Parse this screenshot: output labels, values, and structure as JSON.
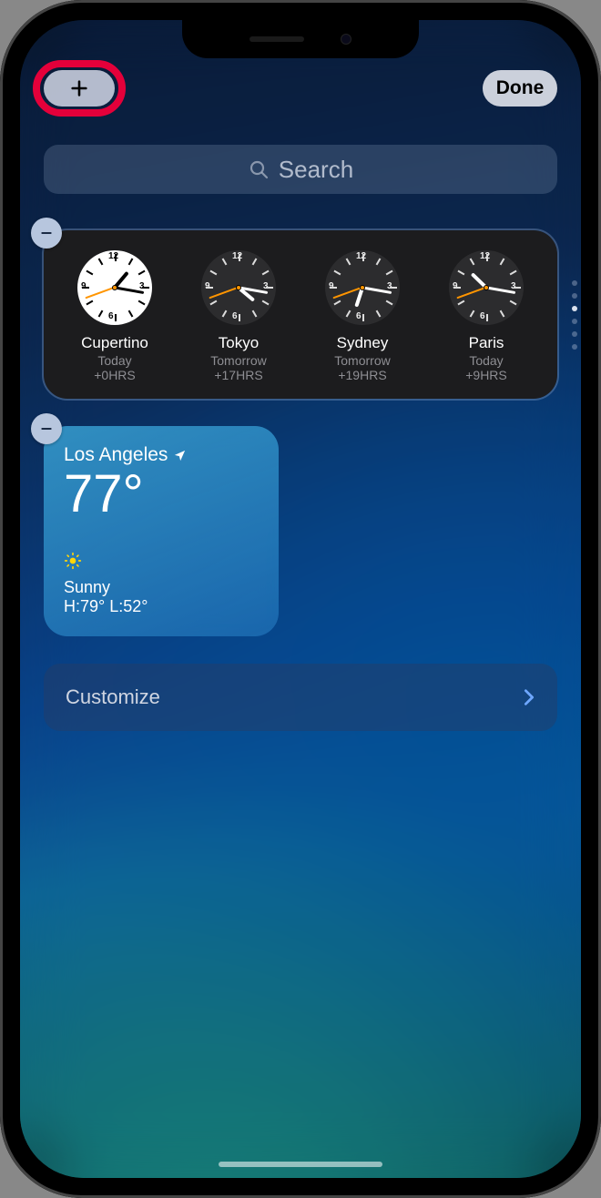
{
  "top": {
    "add_label": "+",
    "done_label": "Done"
  },
  "search": {
    "placeholder": "Search"
  },
  "world_clock": {
    "page_count": 6,
    "page_active": 2,
    "clocks": [
      {
        "city": "Cupertino",
        "day": "Today",
        "offset": "+0HRS",
        "face": "light",
        "hour_angle": 40,
        "minute_angle": 100,
        "second_angle": 250
      },
      {
        "city": "Tokyo",
        "day": "Tomorrow",
        "offset": "+17HRS",
        "face": "dark",
        "hour_angle": 130,
        "minute_angle": 100,
        "second_angle": 250
      },
      {
        "city": "Sydney",
        "day": "Tomorrow",
        "offset": "+19HRS",
        "face": "dark",
        "hour_angle": 198,
        "minute_angle": 100,
        "second_angle": 250
      },
      {
        "city": "Paris",
        "day": "Today",
        "offset": "+9HRS",
        "face": "dark",
        "hour_angle": 314,
        "minute_angle": 100,
        "second_angle": 250
      }
    ]
  },
  "weather": {
    "location": "Los Angeles",
    "temperature": "77°",
    "condition": "Sunny",
    "high_low": "H:79° L:52°"
  },
  "customize": {
    "label": "Customize"
  }
}
